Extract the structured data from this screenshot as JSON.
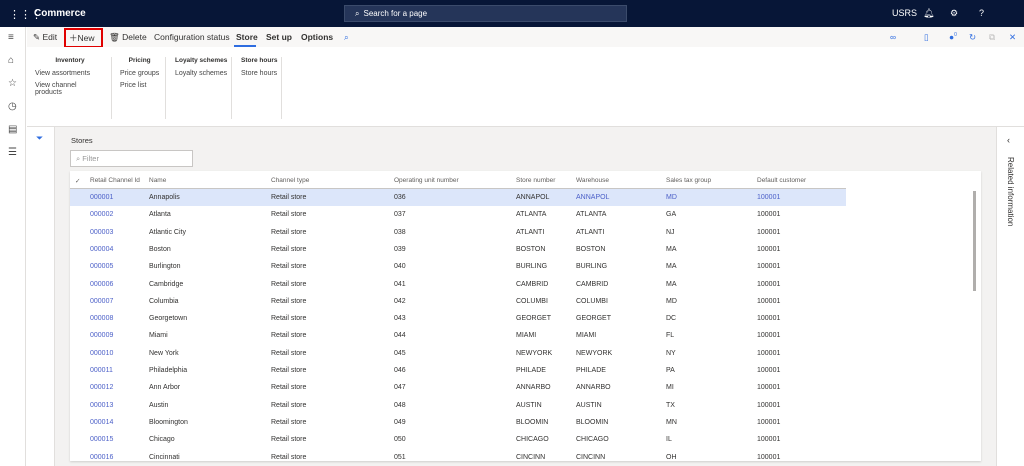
{
  "topbar": {
    "app_title": "Commerce",
    "search_placeholder": "Search for a page",
    "company": "USRS"
  },
  "toolbar": {
    "edit": "Edit",
    "new": "New",
    "delete": "Delete",
    "config_status": "Configuration status",
    "tabs": [
      "Store",
      "Set up",
      "Options"
    ],
    "notification_count": "0"
  },
  "ribbon": {
    "groups": [
      {
        "title": "Inventory",
        "items": [
          "View assortments",
          "View channel products"
        ]
      },
      {
        "title": "Pricing",
        "items": [
          "Price groups",
          "Price list"
        ]
      },
      {
        "title": "Loyalty schemes",
        "items": [
          "Loyalty schemes"
        ]
      },
      {
        "title": "Store hours",
        "items": [
          "Store hours"
        ]
      }
    ]
  },
  "related_info": "Related information",
  "grid": {
    "title": "Stores",
    "filter_placeholder": "Filter",
    "columns": [
      "Retail Channel Id",
      "Name",
      "Channel type",
      "Operating unit number",
      "Store number",
      "Warehouse",
      "Sales tax group",
      "Default customer"
    ],
    "rows": [
      [
        "000001",
        "Annapolis",
        "Retail store",
        "036",
        "ANNAPOL",
        "ANNAPOL",
        "MD",
        "100001"
      ],
      [
        "000002",
        "Atlanta",
        "Retail store",
        "037",
        "ATLANTA",
        "ATLANTA",
        "GA",
        "100001"
      ],
      [
        "000003",
        "Atlantic City",
        "Retail store",
        "038",
        "ATLANTI",
        "ATLANTI",
        "NJ",
        "100001"
      ],
      [
        "000004",
        "Boston",
        "Retail store",
        "039",
        "BOSTON",
        "BOSTON",
        "MA",
        "100001"
      ],
      [
        "000005",
        "Burlington",
        "Retail store",
        "040",
        "BURLING",
        "BURLING",
        "MA",
        "100001"
      ],
      [
        "000006",
        "Cambridge",
        "Retail store",
        "041",
        "CAMBRID",
        "CAMBRID",
        "MA",
        "100001"
      ],
      [
        "000007",
        "Columbia",
        "Retail store",
        "042",
        "COLUMBI",
        "COLUMBI",
        "MD",
        "100001"
      ],
      [
        "000008",
        "Georgetown",
        "Retail store",
        "043",
        "GEORGET",
        "GEORGET",
        "DC",
        "100001"
      ],
      [
        "000009",
        "Miami",
        "Retail store",
        "044",
        "MIAMI",
        "MIAMI",
        "FL",
        "100001"
      ],
      [
        "000010",
        "New York",
        "Retail store",
        "045",
        "NEWYORK",
        "NEWYORK",
        "NY",
        "100001"
      ],
      [
        "000011",
        "Philadelphia",
        "Retail store",
        "046",
        "PHILADE",
        "PHILADE",
        "PA",
        "100001"
      ],
      [
        "000012",
        "Ann Arbor",
        "Retail store",
        "047",
        "ANNARBO",
        "ANNARBO",
        "MI",
        "100001"
      ],
      [
        "000013",
        "Austin",
        "Retail store",
        "048",
        "AUSTIN",
        "AUSTIN",
        "TX",
        "100001"
      ],
      [
        "000014",
        "Bloomington",
        "Retail store",
        "049",
        "BLOOMIN",
        "BLOOMIN",
        "MN",
        "100001"
      ],
      [
        "000015",
        "Chicago",
        "Retail store",
        "050",
        "CHICAGO",
        "CHICAGO",
        "IL",
        "100001"
      ],
      [
        "000016",
        "Cincinnati",
        "Retail store",
        "051",
        "CINCINN",
        "CINCINN",
        "OH",
        "100001"
      ]
    ]
  },
  "colors": {
    "topbar": "#071637",
    "accent": "#2f6de0",
    "link": "#4c60c8",
    "selected_row": "#dce6fa",
    "highlight_box": "#e00000"
  }
}
